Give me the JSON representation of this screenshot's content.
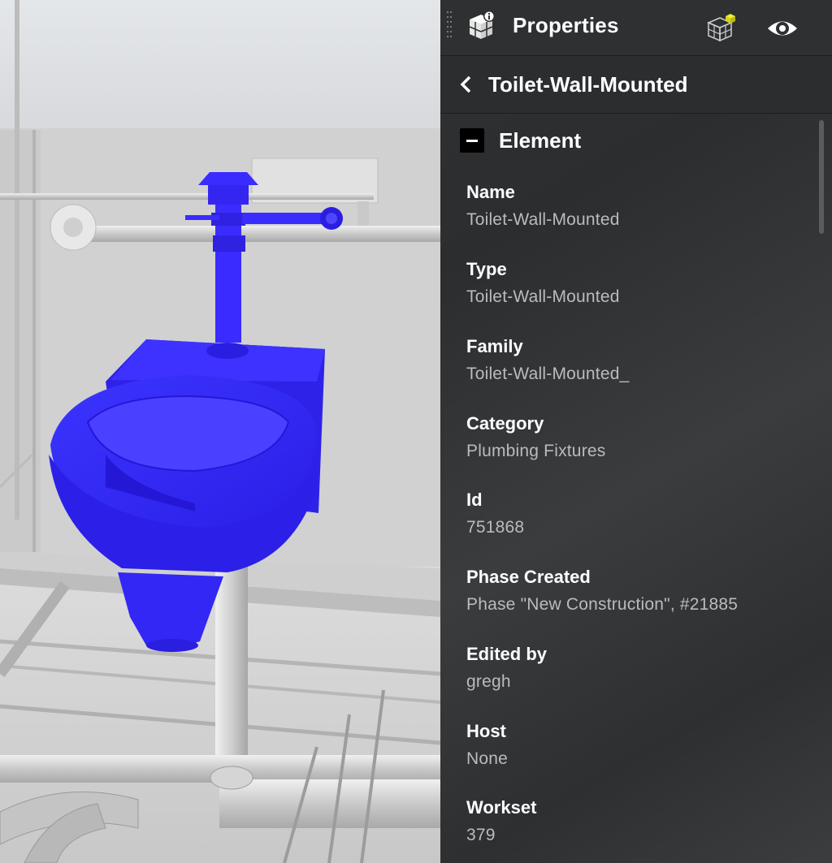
{
  "panel": {
    "title": "Properties",
    "icons": {
      "logo": "model-properties-icon",
      "cube": "model-cube-icon",
      "eye": "eye-icon",
      "back": "chevron-left-icon"
    },
    "breadcrumb": "Toilet-Wall-Mounted",
    "section": {
      "title": "Element",
      "properties": [
        {
          "key": "Name",
          "value": "Toilet-Wall-Mounted"
        },
        {
          "key": "Type",
          "value": "Toilet-Wall-Mounted"
        },
        {
          "key": "Family",
          "value": "Toilet-Wall-Mounted_"
        },
        {
          "key": "Category",
          "value": "Plumbing Fixtures"
        },
        {
          "key": "Id",
          "value": "751868"
        },
        {
          "key": "Phase Created",
          "value": "Phase \"New Construction\", #21885"
        },
        {
          "key": "Edited by",
          "value": "gregh"
        },
        {
          "key": "Host",
          "value": "None"
        },
        {
          "key": "Workset",
          "value": "379"
        }
      ]
    }
  },
  "colors": {
    "selection": "#3a2bff",
    "panel_bg": "#2f3133",
    "value_text": "#b9bbbd",
    "cube_highlight": "#f2ee2a"
  }
}
